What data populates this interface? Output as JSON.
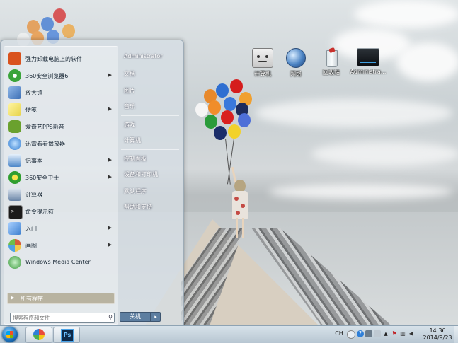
{
  "desktop": {
    "icons": [
      {
        "label": "计算机",
        "icon": "computer-icon"
      },
      {
        "label": "网络",
        "icon": "network-icon"
      },
      {
        "label": "回收站",
        "icon": "recycle-bin-icon"
      },
      {
        "label": "Administra...",
        "icon": "user-folder-icon"
      }
    ]
  },
  "start_menu": {
    "programs": [
      {
        "label": "强力卸载电脑上的软件",
        "icon": "uninstall-icon",
        "has_submenu": false,
        "color": "#d9531e"
      },
      {
        "label": "360安全浏览器6",
        "icon": "360-browser-icon",
        "has_submenu": true,
        "color": "#3aa43a"
      },
      {
        "label": "放大镜",
        "icon": "magnifier-icon",
        "has_submenu": false,
        "color": "#3d6fb5"
      },
      {
        "label": "便笺",
        "icon": "sticky-notes-icon",
        "has_submenu": true,
        "color": "#e6d24a"
      },
      {
        "label": "爱奇艺PPS影音",
        "icon": "pps-icon",
        "has_submenu": false,
        "color": "#6aa12e"
      },
      {
        "label": "迅雷看看播放器",
        "icon": "xunlei-player-icon",
        "has_submenu": false,
        "color": "#2e7bd1"
      },
      {
        "label": "记事本",
        "icon": "notepad-icon",
        "has_submenu": true,
        "color": "#4d87c9"
      },
      {
        "label": "360安全卫士",
        "icon": "360-safe-icon",
        "has_submenu": true,
        "color": "#2f9e2f"
      },
      {
        "label": "计算器",
        "icon": "calculator-icon",
        "has_submenu": false,
        "color": "#6b86a8"
      },
      {
        "label": "命令提示符",
        "icon": "cmd-icon",
        "has_submenu": false,
        "color": "#1b1b1b"
      },
      {
        "label": "入门",
        "icon": "getting-started-icon",
        "has_submenu": true,
        "color": "#3c7fcf"
      },
      {
        "label": "画图",
        "icon": "paint-icon",
        "has_submenu": true,
        "color": "#d65d3b"
      },
      {
        "label": "Windows Media Center",
        "icon": "media-center-icon",
        "has_submenu": false,
        "color": "#3a9a3a"
      }
    ],
    "all_programs": "所有程序",
    "search_placeholder": "搜索程序和文件",
    "right_items": [
      "Administrator",
      "文档",
      "图片",
      "音乐",
      "游戏",
      "计算机",
      "控制面板",
      "设备和打印机",
      "默认程序",
      "帮助和支持"
    ],
    "shutdown_label": "关机",
    "shutdown_arrow": "▸"
  },
  "taskbar": {
    "apps": [
      {
        "name": "360-browser",
        "icon": "360-browser-icon"
      },
      {
        "name": "photoshop",
        "icon": "photoshop-icon",
        "label": "Ps"
      }
    ],
    "tray": {
      "ime": "CH",
      "time": "14:36",
      "date": "2014/9/23"
    }
  }
}
